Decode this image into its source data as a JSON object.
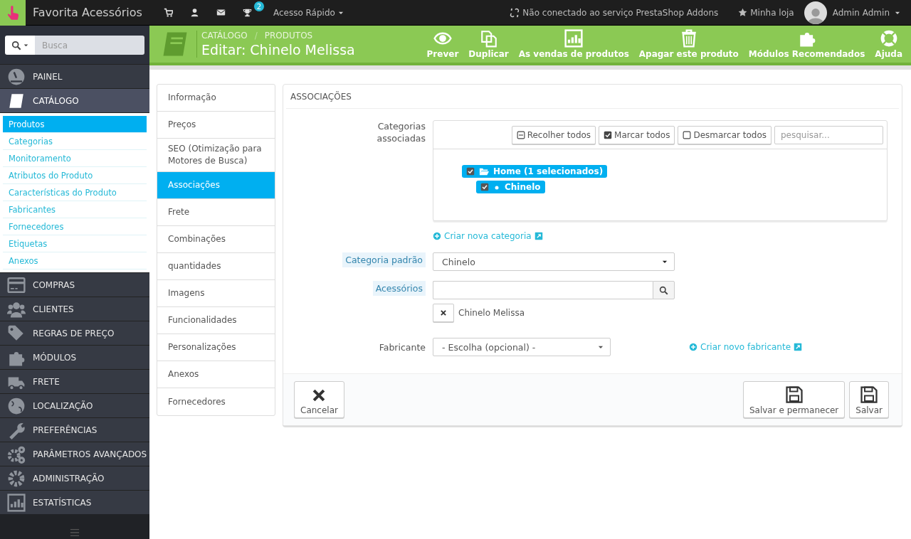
{
  "topbar": {
    "shop_name": "Favorita Acessórios",
    "notifications": [
      {
        "kind": "cart"
      },
      {
        "kind": "user"
      },
      {
        "kind": "envelope"
      },
      {
        "kind": "trophy",
        "count": "2"
      }
    ],
    "quick_access": "Acesso Rápido",
    "addons_status": "Não conectado ao serviço PrestaShop Addons",
    "my_shop": "Minha loja",
    "user": "Admin Admin"
  },
  "sidebar": {
    "search": {
      "placeholder": "Busca"
    },
    "menu": [
      {
        "label": "PAINEL",
        "selected": false
      },
      {
        "label": "CATÁLOGO",
        "selected": true,
        "children": [
          {
            "label": "Produtos",
            "selected": true
          },
          {
            "label": "Categorias",
            "selected": false
          },
          {
            "label": "Monitoramento",
            "selected": false
          },
          {
            "label": "Atributos do Produto",
            "selected": false
          },
          {
            "label": "Características do Produto",
            "selected": false
          },
          {
            "label": "Fabricantes",
            "selected": false
          },
          {
            "label": "Fornecedores",
            "selected": false
          },
          {
            "label": "Etiquetas",
            "selected": false
          },
          {
            "label": "Anexos",
            "selected": false
          }
        ]
      },
      {
        "label": "COMPRAS",
        "selected": false
      },
      {
        "label": "CLIENTES",
        "selected": false
      },
      {
        "label": "REGRAS DE PREÇO",
        "selected": false
      },
      {
        "label": "MÓDULOS",
        "selected": false
      },
      {
        "label": "FRETE",
        "selected": false
      },
      {
        "label": "LOCALIZAÇÃO",
        "selected": false
      },
      {
        "label": "PREFERÊNCIAS",
        "selected": false
      },
      {
        "label": "PARÂMETROS AVANÇADOS",
        "selected": false
      },
      {
        "label": "ADMINISTRAÇÃO",
        "selected": false
      },
      {
        "label": "ESTATÍSTICAS",
        "selected": false
      }
    ]
  },
  "header": {
    "breadcrumb": [
      "CATÁLOGO",
      "PRODUTOS"
    ],
    "breadcrumb_separator": "/",
    "title": "Editar: Chinelo Melissa",
    "toolbar": [
      "Prever",
      "Duplicar",
      "As vendas de produtos",
      "Apagar este produto",
      "Módulos Recomendados",
      "Ajuda"
    ]
  },
  "tabs": [
    {
      "label": "Informação",
      "selected": false
    },
    {
      "label": "Preços",
      "selected": false
    },
    {
      "label": "SEO (Otimização para Motores de Busca)",
      "selected": false
    },
    {
      "label": "Associações",
      "selected": true
    },
    {
      "label": "Frete",
      "selected": false
    },
    {
      "label": "Combinações",
      "selected": false
    },
    {
      "label": "quantidades",
      "selected": false
    },
    {
      "label": "Imagens",
      "selected": false
    },
    {
      "label": "Funcionalidades",
      "selected": false
    },
    {
      "label": "Personalizações",
      "selected": false
    },
    {
      "label": "Anexos",
      "selected": false
    },
    {
      "label": "Fornecedores",
      "selected": false
    }
  ],
  "panel": {
    "title": "ASSOCIAÇÕES",
    "categories": {
      "label": "Categorias associadas",
      "buttons": [
        "Recolher todos",
        "Marcar todos",
        "Desmarcar todos"
      ],
      "search": {
        "placeholder": "pesquisar..."
      },
      "tree": [
        {
          "label": "Home (1 selecionados)",
          "checked": true,
          "children": [
            {
              "label": "Chinelo",
              "checked": true
            }
          ]
        }
      ]
    },
    "create_category": "Criar nova categoria",
    "default_category": {
      "label": "Categoria padrão",
      "value": "Chinelo"
    },
    "accessories": {
      "label": "Acessórios",
      "items": [
        "Chinelo Melissa"
      ]
    },
    "manufacturer": {
      "label": "Fabricante",
      "value": "- Escolha (opcional) -",
      "create": "Criar novo fabricante"
    },
    "footer": {
      "cancel": "Cancelar",
      "save_stay": "Salvar e permanecer",
      "save": "Salvar"
    }
  }
}
